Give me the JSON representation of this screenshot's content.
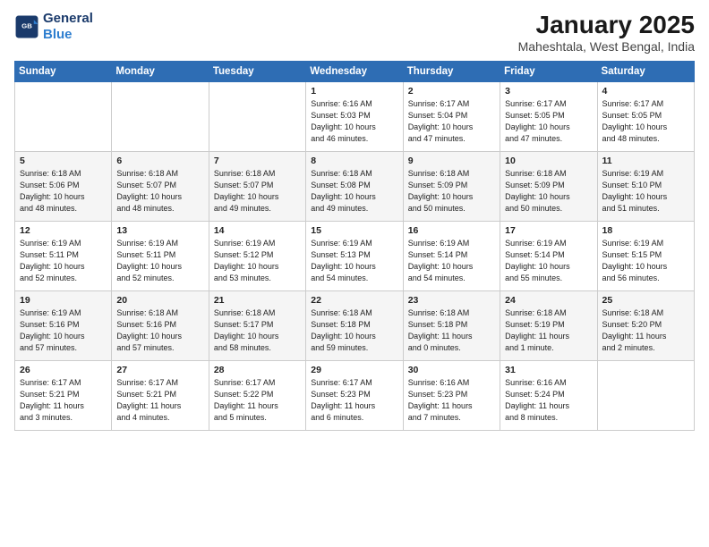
{
  "logo": {
    "line1": "General",
    "line2": "Blue"
  },
  "title": "January 2025",
  "subtitle": "Maheshtala, West Bengal, India",
  "days_of_week": [
    "Sunday",
    "Monday",
    "Tuesday",
    "Wednesday",
    "Thursday",
    "Friday",
    "Saturday"
  ],
  "weeks": [
    [
      {
        "day": "",
        "info": ""
      },
      {
        "day": "",
        "info": ""
      },
      {
        "day": "",
        "info": ""
      },
      {
        "day": "1",
        "info": "Sunrise: 6:16 AM\nSunset: 5:03 PM\nDaylight: 10 hours\nand 46 minutes."
      },
      {
        "day": "2",
        "info": "Sunrise: 6:17 AM\nSunset: 5:04 PM\nDaylight: 10 hours\nand 47 minutes."
      },
      {
        "day": "3",
        "info": "Sunrise: 6:17 AM\nSunset: 5:05 PM\nDaylight: 10 hours\nand 47 minutes."
      },
      {
        "day": "4",
        "info": "Sunrise: 6:17 AM\nSunset: 5:05 PM\nDaylight: 10 hours\nand 48 minutes."
      }
    ],
    [
      {
        "day": "5",
        "info": "Sunrise: 6:18 AM\nSunset: 5:06 PM\nDaylight: 10 hours\nand 48 minutes."
      },
      {
        "day": "6",
        "info": "Sunrise: 6:18 AM\nSunset: 5:07 PM\nDaylight: 10 hours\nand 48 minutes."
      },
      {
        "day": "7",
        "info": "Sunrise: 6:18 AM\nSunset: 5:07 PM\nDaylight: 10 hours\nand 49 minutes."
      },
      {
        "day": "8",
        "info": "Sunrise: 6:18 AM\nSunset: 5:08 PM\nDaylight: 10 hours\nand 49 minutes."
      },
      {
        "day": "9",
        "info": "Sunrise: 6:18 AM\nSunset: 5:09 PM\nDaylight: 10 hours\nand 50 minutes."
      },
      {
        "day": "10",
        "info": "Sunrise: 6:18 AM\nSunset: 5:09 PM\nDaylight: 10 hours\nand 50 minutes."
      },
      {
        "day": "11",
        "info": "Sunrise: 6:19 AM\nSunset: 5:10 PM\nDaylight: 10 hours\nand 51 minutes."
      }
    ],
    [
      {
        "day": "12",
        "info": "Sunrise: 6:19 AM\nSunset: 5:11 PM\nDaylight: 10 hours\nand 52 minutes."
      },
      {
        "day": "13",
        "info": "Sunrise: 6:19 AM\nSunset: 5:11 PM\nDaylight: 10 hours\nand 52 minutes."
      },
      {
        "day": "14",
        "info": "Sunrise: 6:19 AM\nSunset: 5:12 PM\nDaylight: 10 hours\nand 53 minutes."
      },
      {
        "day": "15",
        "info": "Sunrise: 6:19 AM\nSunset: 5:13 PM\nDaylight: 10 hours\nand 54 minutes."
      },
      {
        "day": "16",
        "info": "Sunrise: 6:19 AM\nSunset: 5:14 PM\nDaylight: 10 hours\nand 54 minutes."
      },
      {
        "day": "17",
        "info": "Sunrise: 6:19 AM\nSunset: 5:14 PM\nDaylight: 10 hours\nand 55 minutes."
      },
      {
        "day": "18",
        "info": "Sunrise: 6:19 AM\nSunset: 5:15 PM\nDaylight: 10 hours\nand 56 minutes."
      }
    ],
    [
      {
        "day": "19",
        "info": "Sunrise: 6:19 AM\nSunset: 5:16 PM\nDaylight: 10 hours\nand 57 minutes."
      },
      {
        "day": "20",
        "info": "Sunrise: 6:18 AM\nSunset: 5:16 PM\nDaylight: 10 hours\nand 57 minutes."
      },
      {
        "day": "21",
        "info": "Sunrise: 6:18 AM\nSunset: 5:17 PM\nDaylight: 10 hours\nand 58 minutes."
      },
      {
        "day": "22",
        "info": "Sunrise: 6:18 AM\nSunset: 5:18 PM\nDaylight: 10 hours\nand 59 minutes."
      },
      {
        "day": "23",
        "info": "Sunrise: 6:18 AM\nSunset: 5:18 PM\nDaylight: 11 hours\nand 0 minutes."
      },
      {
        "day": "24",
        "info": "Sunrise: 6:18 AM\nSunset: 5:19 PM\nDaylight: 11 hours\nand 1 minute."
      },
      {
        "day": "25",
        "info": "Sunrise: 6:18 AM\nSunset: 5:20 PM\nDaylight: 11 hours\nand 2 minutes."
      }
    ],
    [
      {
        "day": "26",
        "info": "Sunrise: 6:17 AM\nSunset: 5:21 PM\nDaylight: 11 hours\nand 3 minutes."
      },
      {
        "day": "27",
        "info": "Sunrise: 6:17 AM\nSunset: 5:21 PM\nDaylight: 11 hours\nand 4 minutes."
      },
      {
        "day": "28",
        "info": "Sunrise: 6:17 AM\nSunset: 5:22 PM\nDaylight: 11 hours\nand 5 minutes."
      },
      {
        "day": "29",
        "info": "Sunrise: 6:17 AM\nSunset: 5:23 PM\nDaylight: 11 hours\nand 6 minutes."
      },
      {
        "day": "30",
        "info": "Sunrise: 6:16 AM\nSunset: 5:23 PM\nDaylight: 11 hours\nand 7 minutes."
      },
      {
        "day": "31",
        "info": "Sunrise: 6:16 AM\nSunset: 5:24 PM\nDaylight: 11 hours\nand 8 minutes."
      },
      {
        "day": "",
        "info": ""
      }
    ]
  ]
}
